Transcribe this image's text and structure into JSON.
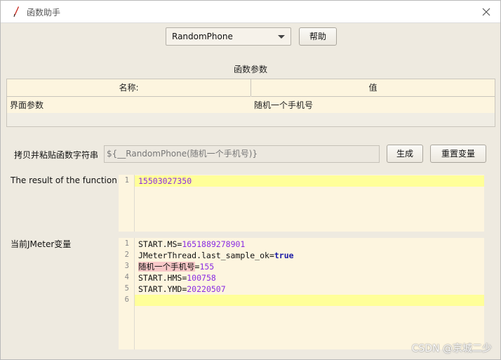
{
  "window": {
    "title": "函数助手"
  },
  "function_select": {
    "selected": "RandomPhone",
    "help_label": "帮助"
  },
  "params": {
    "section_title": "函数参数",
    "col_name": "名称:",
    "col_value": "值",
    "rows": [
      {
        "name": "界面参数",
        "value": "随机一个手机号"
      }
    ]
  },
  "copy_row": {
    "label": "拷贝并粘贴函数字符串",
    "function_string": "${__RandomPhone(随机一个手机号)}",
    "generate_label": "生成",
    "reset_label": "重置变量"
  },
  "result": {
    "label": "The result of the function is",
    "lines": [
      "15503027350"
    ]
  },
  "jmeter_vars": {
    "label": "当前JMeter变量",
    "lines": [
      {
        "key": "START.MS",
        "value": "1651889278901"
      },
      {
        "key": "JMeterThread.last_sample_ok",
        "value": "true"
      },
      {
        "key": "随机一个手机号",
        "value": "155"
      },
      {
        "key": "START.HMS",
        "value": "100758"
      },
      {
        "key": "START.YMD",
        "value": "20220507"
      }
    ],
    "line_numbers": [
      "1",
      "2",
      "3",
      "4",
      "5",
      "6"
    ]
  },
  "watermark": "CSDN @京城二少",
  "colors": {
    "panel_bg": "#eeeae0",
    "editor_bg": "#fdf5df",
    "current_line": "#ffff99",
    "number_color": "#8a2be2",
    "keyword_color": "#1a1aa6"
  }
}
